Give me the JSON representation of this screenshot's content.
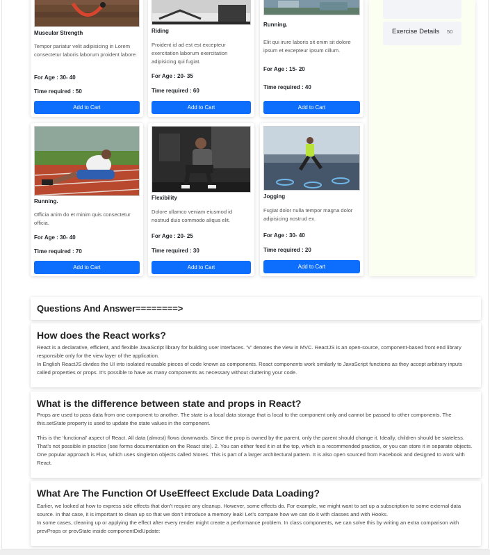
{
  "cards": [
    {
      "title": "Muscular Strength",
      "desc": "Tempor pariatur velit adipisicing in Lorem consectetur laboris laborum proident labore.",
      "age": "For Age : 30- 40",
      "time": "Time required : 50",
      "button": "Add to Cart"
    },
    {
      "title": "Riding",
      "desc": "Proident id ad est est excepteur exercitation laborum exercitation adipisicing qui fugiat.",
      "age": "For Age : 20- 35",
      "time": "Time required : 60",
      "button": "Add to Cart"
    },
    {
      "title": "Running.",
      "desc": "Elit qui irure laboris sit enim sit dolore ipsum et excepteur ipsum cillum.",
      "age": "For Age : 15- 20",
      "time": "Time required : 40",
      "button": "Add to Cart"
    },
    {
      "title": "Running.",
      "desc": "Officia anim do et minim quis consectetur officia.",
      "age": "For Age : 30- 40",
      "time": "Time required : 70",
      "button": "Add to Cart"
    },
    {
      "title": "Flexibility",
      "desc": "Dolore ullamco veniam eiusmod id nostrud duis commodo aliqua elit.",
      "age": "For Age : 20- 25",
      "time": "Time required : 30",
      "button": "Add to Cart"
    },
    {
      "title": "Jogging",
      "desc": "Fugiat dolor nulla tempor magna dolor adipisicing nostrud ex.",
      "age": "For Age : 30- 40",
      "time": "Time required : 20",
      "button": "Add to Cart"
    }
  ],
  "sidebar": {
    "exercise_label": "Exercise Details",
    "exercise_value": "50"
  },
  "qa": {
    "heading": "Questions And Answer========>",
    "items": [
      {
        "question": "How does the React works?",
        "p1": "React is a declarative, efficient, and flexible JavaScript library for building user interfaces. ‘V’ denotes the view in MVC. ReactJS is an open-source, component-based front end library responsible only for the view layer of the application.",
        "p2": "In English ReactJS divides the UI into isolated reusable pieces of code known as components. React components work similarly to JavaScript functions as they accept arbitrary inputs called properties or props. It’s possible to have as many components as necessary without cluttering your code."
      },
      {
        "question": "What is the difference between state and props in React?",
        "p1": "Props are used to pass data from one component to another. The state is a local data storage that is local to the component only and cannot be passed to other components. The this.setState property is used to update the state values in the component.",
        "p2": "This is the ‘functional’ aspect of React. All data (almost) flows downwards. Since the prop is owned by the parent, only the parent should change it. Ideally, children should be stateless. That’s not possible in practice (see forms documentation on the React site). 2. You can either feed it in at the top, which is a recommended practice, or you can store it in separate objects. One popular approach is Flux, which uses singleton objects called Stores. This is part of a larger architectural pattern. It is also open sourced from Facebook and designed to work with React."
      },
      {
        "question": "What Are The Function Of UseEffeect Exclude Data Loading?",
        "p1": "Earlier, we looked at how to express side effects that don’t require any cleanup. However, some effects do. For example, we might want to set up a subscription to some external data source. In that case, it is important to clean up so that we don’t introduce a memory leak! Let’s compare how we can do it with classes and with Hooks.",
        "p2": "In some cases, cleaning up or applying the effect after every render might create a performance problem. In class components, we can solve this by writing an extra comparison with prevProps or prevState inside componentDidUpdate:"
      }
    ]
  }
}
